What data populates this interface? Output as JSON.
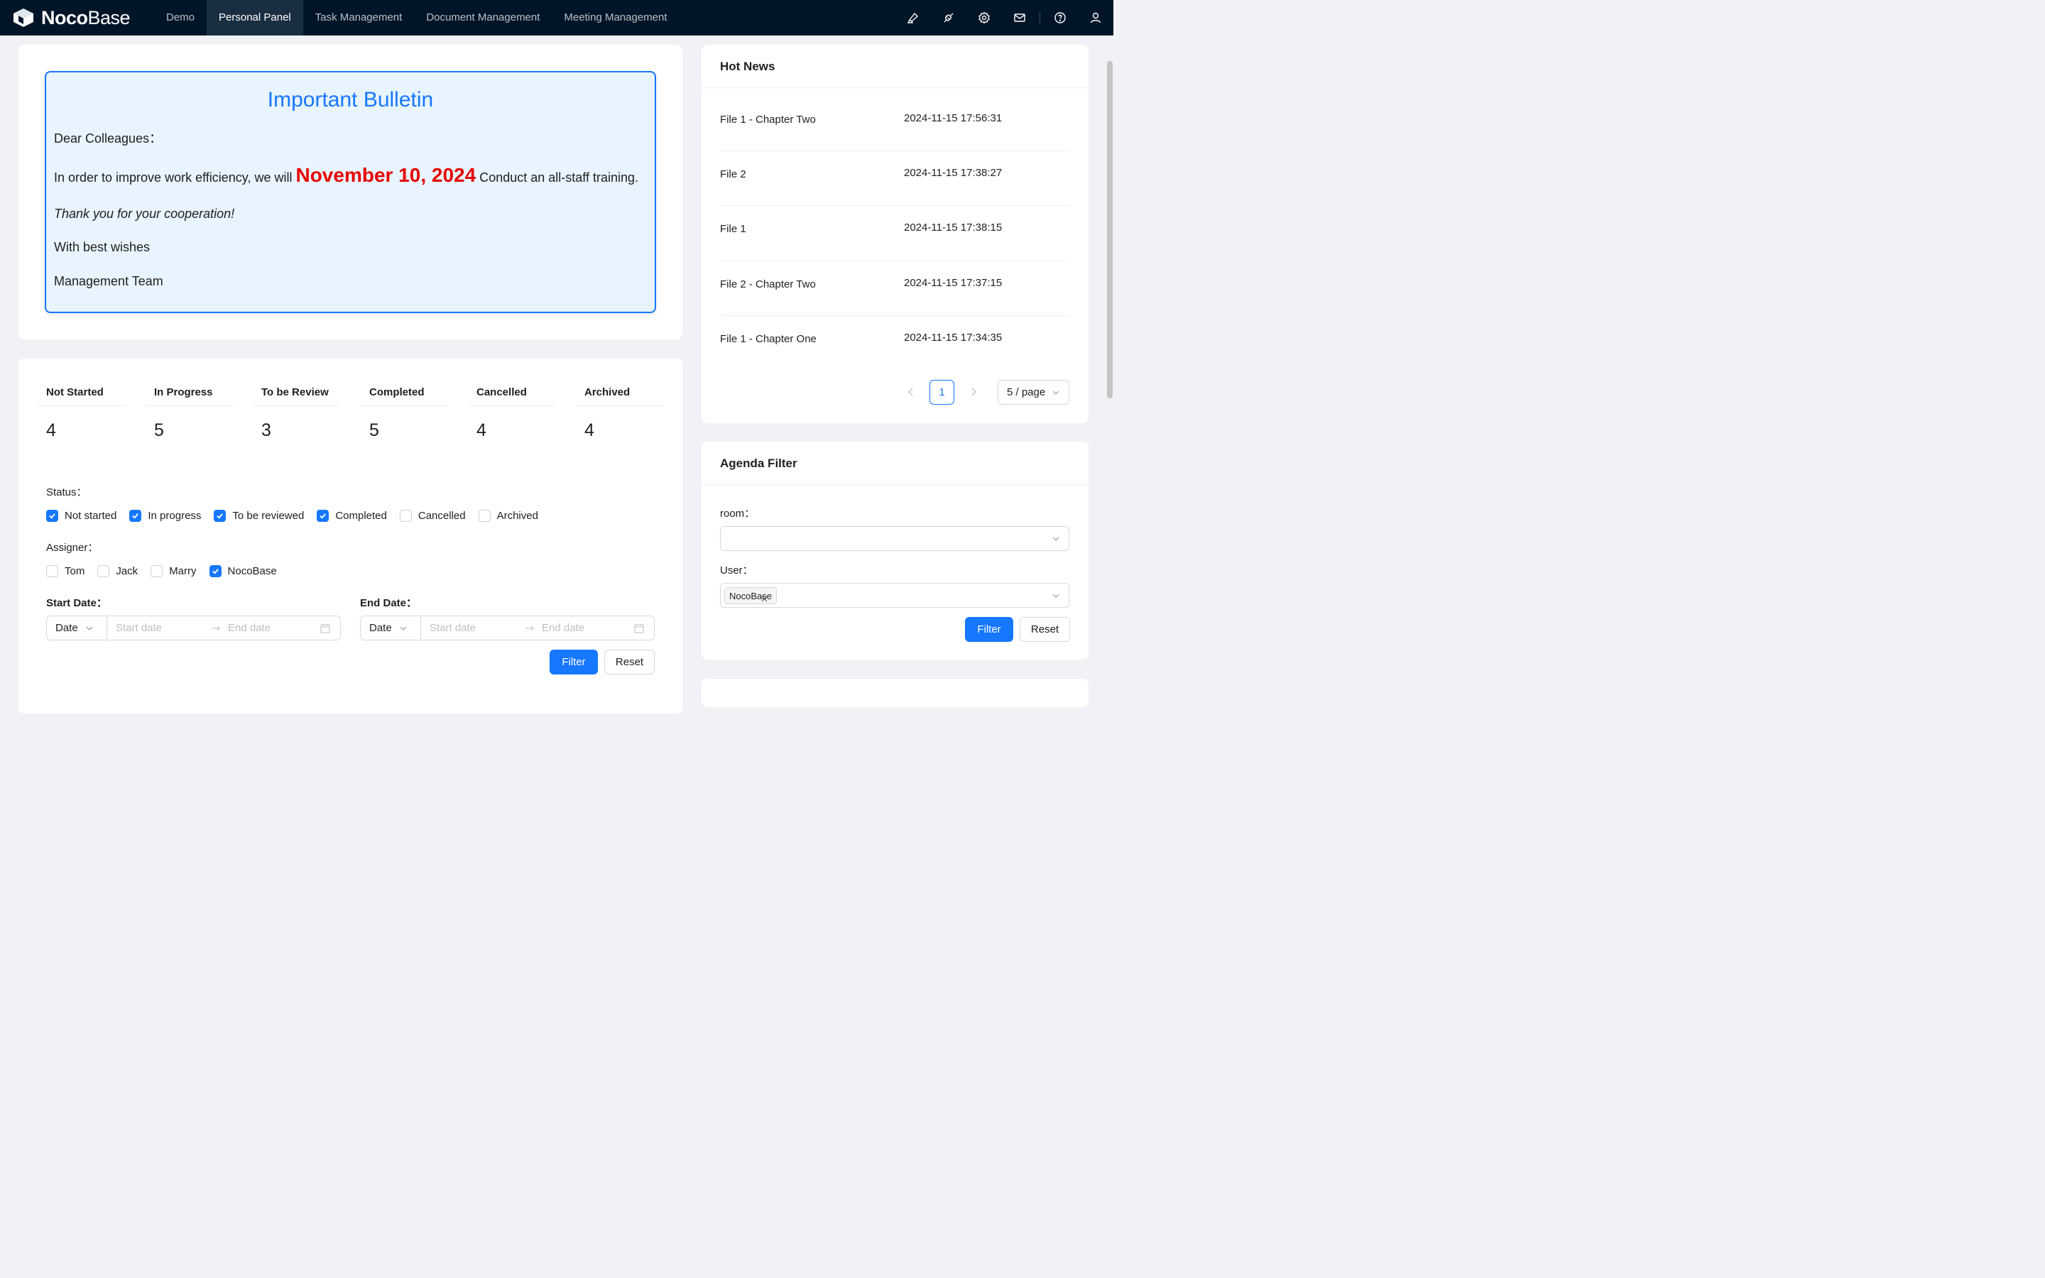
{
  "header": {
    "logo_bold": "Noco",
    "logo_light": "Base",
    "nav": [
      "Demo",
      "Personal Panel",
      "Task Management",
      "Document Management",
      "Meeting Management"
    ],
    "active_nav": "Personal Panel",
    "icons": [
      "highlighter-icon",
      "plugin-icon",
      "gear-icon",
      "mail-icon",
      "help-icon",
      "user-icon"
    ]
  },
  "bulletin": {
    "title": "Important Bulletin",
    "greeting": "Dear Colleagues：",
    "line_prefix": "In order to improve work efficiency, we will",
    "date": "November 10, 2024",
    "line_suffix": "Conduct an all-staff training.",
    "thanks": "Thank you for your cooperation!",
    "wishes": "With best wishes",
    "signature": "Management Team",
    "colors": {
      "border": "#1677ff",
      "title": "#1677ff",
      "date": "#e60000",
      "background": "#e8f4ff"
    }
  },
  "stats": [
    {
      "title": "Not Started",
      "value": "4"
    },
    {
      "title": "In Progress",
      "value": "5"
    },
    {
      "title": "To be Review",
      "value": "3"
    },
    {
      "title": "Completed",
      "value": "5"
    },
    {
      "title": "Cancelled",
      "value": "4"
    },
    {
      "title": "Archived",
      "value": "4"
    }
  ],
  "filter": {
    "status_label": "Status：",
    "status_options": [
      {
        "label": "Not started",
        "checked": true
      },
      {
        "label": "In progress",
        "checked": true
      },
      {
        "label": "To be reviewed",
        "checked": true
      },
      {
        "label": "Completed",
        "checked": true
      },
      {
        "label": "Cancelled",
        "checked": false
      },
      {
        "label": "Archived",
        "checked": false
      }
    ],
    "assigner_label": "Assigner：",
    "assigner_options": [
      {
        "label": "Tom",
        "checked": false
      },
      {
        "label": "Jack",
        "checked": false
      },
      {
        "label": "Marry",
        "checked": false
      },
      {
        "label": "NocoBase",
        "checked": true
      }
    ],
    "start_date_label": "Start Date：",
    "end_date_label": "End Date：",
    "picker_type": "Date",
    "start_placeholder": "Start date",
    "end_placeholder": "End date",
    "filter_btn": "Filter",
    "reset_btn": "Reset"
  },
  "hot_news": {
    "title": "Hot News",
    "items": [
      {
        "name": "File 1 - Chapter Two",
        "time": "2024-11-15 17:56:31"
      },
      {
        "name": "File 2",
        "time": "2024-11-15 17:38:27"
      },
      {
        "name": "File 1",
        "time": "2024-11-15 17:38:15"
      },
      {
        "name": "File 2 - Chapter Two",
        "time": "2024-11-15 17:37:15"
      },
      {
        "name": "File 1 - Chapter One",
        "time": "2024-11-15 17:34:35"
      }
    ],
    "current_page": "1",
    "page_size": "5 / page"
  },
  "agenda": {
    "title": "Agenda Filter",
    "room_label": "room：",
    "user_label": "User：",
    "user_tag": "NocoBase",
    "filter_btn": "Filter",
    "reset_btn": "Reset"
  }
}
